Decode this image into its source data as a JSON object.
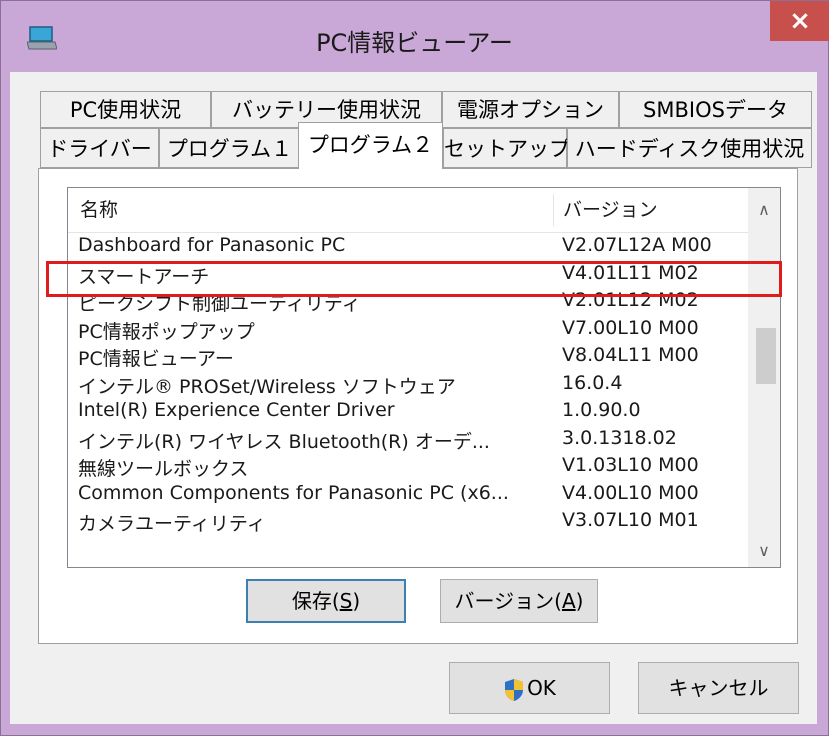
{
  "window": {
    "title": "PC情報ビューアー",
    "close_label": "×"
  },
  "tabs_row1": [
    {
      "label": "PC使用状況"
    },
    {
      "label": "バッテリー使用状況"
    },
    {
      "label": "電源オプション"
    },
    {
      "label": "SMBIOSデータ"
    }
  ],
  "tabs_row2": [
    {
      "label": "ドライバー"
    },
    {
      "label": "プログラム１"
    },
    {
      "label": "プログラム２",
      "active": true
    },
    {
      "label": "セットアップ"
    },
    {
      "label": "ハードディスク使用状況"
    }
  ],
  "list": {
    "columns": {
      "name": "名称",
      "version": "バージョン"
    },
    "rows": [
      {
        "name": "Dashboard for Panasonic PC",
        "version": "V2.07L12A M00"
      },
      {
        "name": "スマートアーチ",
        "version": "V4.01L11 M02",
        "highlighted": true
      },
      {
        "name": "ピークシフト制御ユーティリティ",
        "version": "V2.01L12 M02"
      },
      {
        "name": "PC情報ポップアップ",
        "version": "V7.00L10 M00"
      },
      {
        "name": "PC情報ビューアー",
        "version": "V8.04L11 M00"
      },
      {
        "name": "インテル® PROSet/Wireless ソフトウェア",
        "version": "16.0.4"
      },
      {
        "name": "Intel(R) Experience Center Driver",
        "version": "1.0.90.0"
      },
      {
        "name": "インテル(R) ワイヤレス Bluetooth(R) オーデ...",
        "version": "3.0.1318.02"
      },
      {
        "name": "無線ツールボックス",
        "version": "V1.03L10 M00"
      },
      {
        "name": "Common Components for Panasonic PC (x6...",
        "version": "V4.00L10 M00"
      },
      {
        "name": "カメラユーティリティ",
        "version": "V3.07L10 M01"
      }
    ]
  },
  "buttons": {
    "save": {
      "label": "保存(",
      "mnemonic": "S",
      "suffix": ")"
    },
    "version": {
      "label": "バージョン(",
      "mnemonic": "A",
      "suffix": ")"
    },
    "ok": "OK",
    "cancel": "キャンセル"
  },
  "colors": {
    "frame": "#c9a7d6",
    "close": "#c7504c",
    "highlight": "#e01b1b",
    "default_button_border": "#3c7fb1"
  }
}
